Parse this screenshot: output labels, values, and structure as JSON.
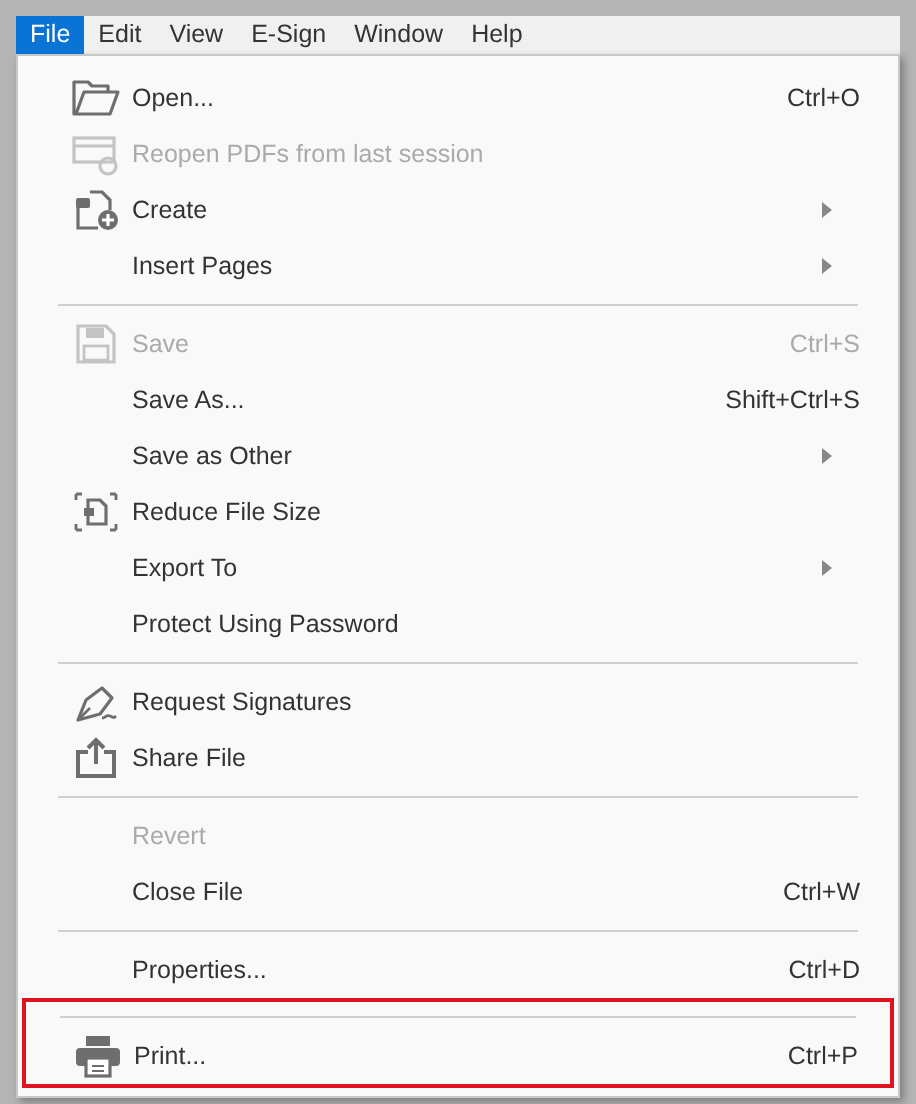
{
  "menubar": [
    {
      "label": "File",
      "selected": true
    },
    {
      "label": "Edit",
      "selected": false
    },
    {
      "label": "View",
      "selected": false
    },
    {
      "label": "E-Sign",
      "selected": false
    },
    {
      "label": "Window",
      "selected": false
    },
    {
      "label": "Help",
      "selected": false
    }
  ],
  "menu": {
    "sections": [
      {
        "highlighted": false,
        "items": [
          {
            "label": "Open...",
            "shortcut": "Ctrl+O",
            "kind": "folder",
            "disabled": false,
            "submenu": false
          },
          {
            "label": "Reopen PDFs from last session",
            "kind": "reopen",
            "disabled": true,
            "submenu": false
          },
          {
            "label": "Create",
            "kind": "create",
            "disabled": false,
            "submenu": true
          },
          {
            "label": "Insert Pages",
            "disabled": false,
            "submenu": true
          }
        ]
      },
      {
        "highlighted": false,
        "items": [
          {
            "label": "Save",
            "shortcut": "Ctrl+S",
            "kind": "save",
            "disabled": true,
            "submenu": false
          },
          {
            "label": "Save As...",
            "shortcut": "Shift+Ctrl+S",
            "disabled": false,
            "submenu": false
          },
          {
            "label": "Save as Other",
            "disabled": false,
            "submenu": true
          },
          {
            "label": "Reduce File Size",
            "kind": "reduce",
            "disabled": false,
            "submenu": false
          },
          {
            "label": "Export To",
            "disabled": false,
            "submenu": true
          },
          {
            "label": "Protect Using Password",
            "disabled": false,
            "submenu": false
          }
        ]
      },
      {
        "highlighted": false,
        "items": [
          {
            "label": "Request Signatures",
            "kind": "pen",
            "disabled": false,
            "submenu": false
          },
          {
            "label": "Share File",
            "kind": "share",
            "disabled": false,
            "submenu": false
          }
        ]
      },
      {
        "highlighted": false,
        "items": [
          {
            "label": "Revert",
            "disabled": true,
            "submenu": false
          },
          {
            "label": "Close File",
            "shortcut": "Ctrl+W",
            "disabled": false,
            "submenu": false
          }
        ]
      },
      {
        "highlighted": false,
        "items": [
          {
            "label": "Properties...",
            "shortcut": "Ctrl+D",
            "disabled": false,
            "submenu": false
          }
        ]
      },
      {
        "highlighted": true,
        "items": [
          {
            "label": "Print...",
            "shortcut": "Ctrl+P",
            "kind": "print",
            "disabled": false,
            "submenu": false
          }
        ]
      }
    ]
  }
}
